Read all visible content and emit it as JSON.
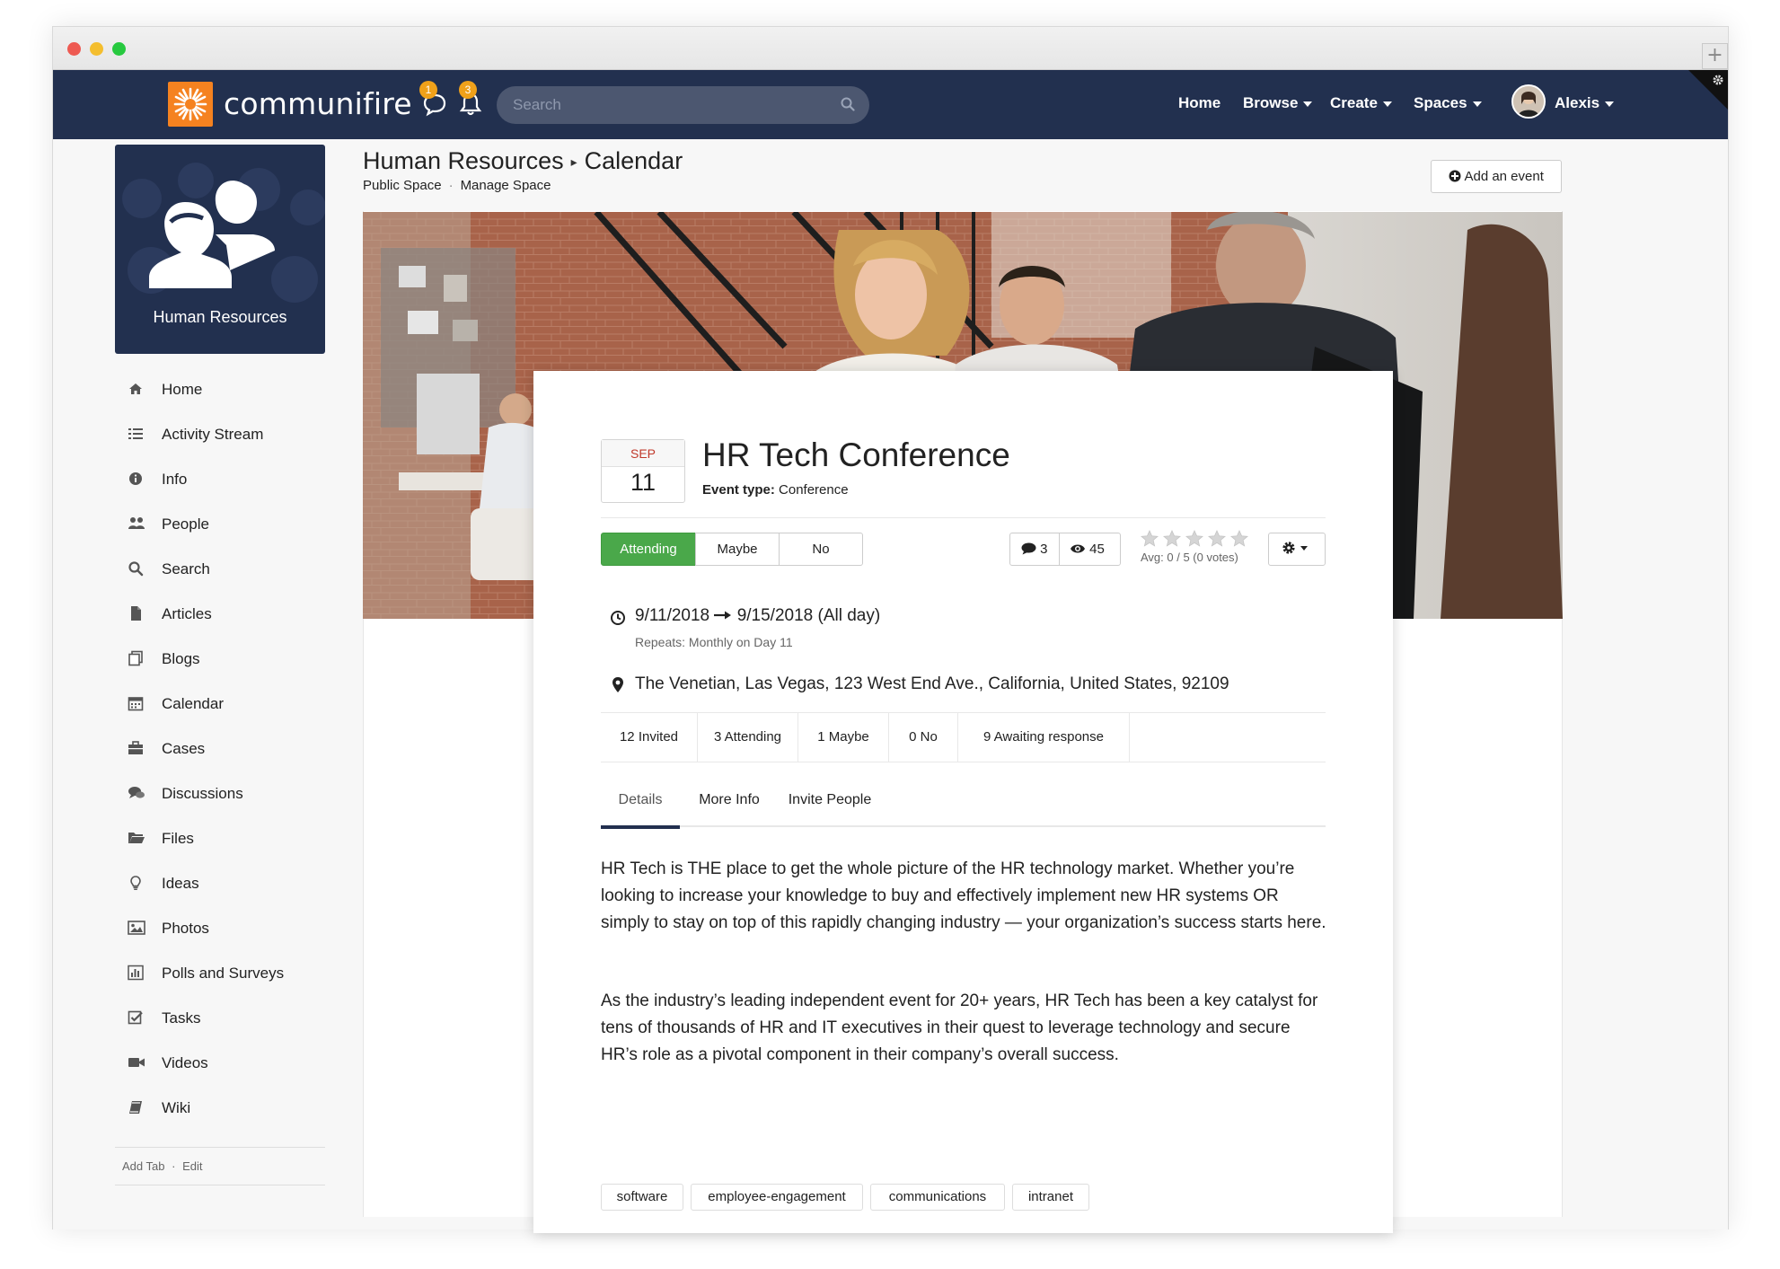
{
  "brand": {
    "name": "communifire",
    "logo_color": "#f58220",
    "navbar_color": "#22304f"
  },
  "topbar": {
    "messages_count": "1",
    "notifications_count": "3",
    "search_placeholder": "Search",
    "nav": [
      "Home",
      "Browse",
      "Create",
      "Spaces"
    ],
    "user_name": "Alexis"
  },
  "space": {
    "name": "Human Resources",
    "title": "Human Resources",
    "page": "Calendar",
    "sub_links": [
      "Public Space",
      "Manage Space"
    ]
  },
  "sidebar": {
    "items": [
      {
        "label": "Home",
        "icon": "home-icon"
      },
      {
        "label": "Activity Stream",
        "icon": "list-icon"
      },
      {
        "label": "Info",
        "icon": "info-icon"
      },
      {
        "label": "People",
        "icon": "people-icon"
      },
      {
        "label": "Search",
        "icon": "search-icon"
      },
      {
        "label": "Articles",
        "icon": "article-icon"
      },
      {
        "label": "Blogs",
        "icon": "blog-icon"
      },
      {
        "label": "Calendar",
        "icon": "calendar-icon"
      },
      {
        "label": "Cases",
        "icon": "briefcase-icon"
      },
      {
        "label": "Discussions",
        "icon": "discussion-icon"
      },
      {
        "label": "Files",
        "icon": "folder-icon"
      },
      {
        "label": "Ideas",
        "icon": "lightbulb-icon"
      },
      {
        "label": "Photos",
        "icon": "photo-icon"
      },
      {
        "label": "Polls and Surveys",
        "icon": "bar-chart-icon"
      },
      {
        "label": "Tasks",
        "icon": "checkbox-icon"
      },
      {
        "label": "Videos",
        "icon": "video-icon"
      },
      {
        "label": "Wiki",
        "icon": "book-icon"
      }
    ],
    "footer_add": "Add Tab",
    "footer_edit": "Edit"
  },
  "actions": {
    "add_event": "Add an event"
  },
  "event": {
    "month": "SEP",
    "day": "11",
    "title": "HR Tech Conference",
    "type_label": "Event type:",
    "type_value": "Conference",
    "rsvp": [
      "Attending",
      "Maybe",
      "No"
    ],
    "rsvp_selected": "Attending",
    "comments": "3",
    "views": "45",
    "rating": {
      "avg_text": "Avg: 0 / 5 (0 votes)",
      "stars_filled": 0,
      "stars_total": 5
    },
    "date_range_start": "9/11/2018",
    "date_range_end": "9/15/2018 (All day)",
    "repeats": "Repeats: Monthly on Day 11",
    "location": "The Venetian, Las Vegas, 123 West End Ave., California, United States, 92109",
    "invite_stats": [
      "12 Invited",
      "3 Attending",
      "1 Maybe",
      "0 No",
      "9 Awaiting response"
    ],
    "tabs": [
      "Details",
      "More Info",
      "Invite People"
    ],
    "active_tab": "Details",
    "description": [
      "HR Tech is THE place to get the whole picture of the HR technology market. Whether you’re looking to increase your knowledge to buy and effectively implement new HR systems OR simply to stay on top of this rapidly changing industry — your organization’s success starts here.",
      "As the industry’s leading independent event for 20+ years, HR Tech has been a key catalyst for tens of thousands of HR and IT executives in their quest to leverage technology and secure HR’s role as a pivotal component in their company’s overall success."
    ],
    "tags": [
      "software",
      "employee-engagement",
      "communications",
      "intranet"
    ]
  },
  "colors": {
    "attending_green": "#4aa84a",
    "badge_orange": "#f0a11a",
    "month_red": "#c0392b"
  }
}
